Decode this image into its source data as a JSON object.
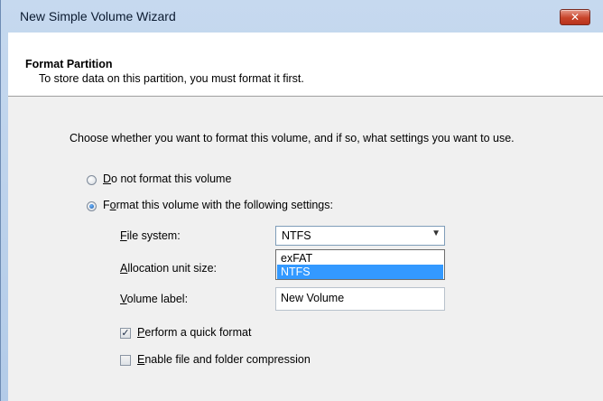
{
  "window": {
    "title": "New Simple Volume Wizard",
    "close_label": "✕"
  },
  "header": {
    "title": "Format Partition",
    "subtitle": "To store data on this partition, you must format it first."
  },
  "instruction": "Choose whether you want to format this volume, and if so, what settings you want to use.",
  "options": {
    "do_not_format": {
      "mnemonic": "D",
      "rest": "o not format this volume",
      "selected": false
    },
    "format_with": {
      "prefix": "F",
      "mnemonic": "o",
      "rest": "rmat this volume with the following settings:",
      "selected": true
    }
  },
  "settings": {
    "file_system": {
      "mnemonic": "F",
      "rest": "ile system:",
      "value": "NTFS",
      "dropdown_options": [
        "exFAT",
        "NTFS"
      ],
      "highlighted": "NTFS"
    },
    "allocation_unit_size": {
      "prefix": "",
      "mnemonic": "A",
      "rest": "llocation unit size:"
    },
    "volume_label": {
      "mnemonic": "V",
      "rest": "olume label:",
      "value": "New Volume"
    }
  },
  "checkboxes": {
    "quick_format": {
      "mnemonic": "P",
      "rest": "erform a quick format",
      "checked": true
    },
    "compression": {
      "mnemonic": "E",
      "rest": "nable file and folder compression",
      "checked": false
    }
  },
  "colors": {
    "title_bar": "#c6d9ef",
    "selection": "#3399ff",
    "close_button": "#c8442a"
  }
}
